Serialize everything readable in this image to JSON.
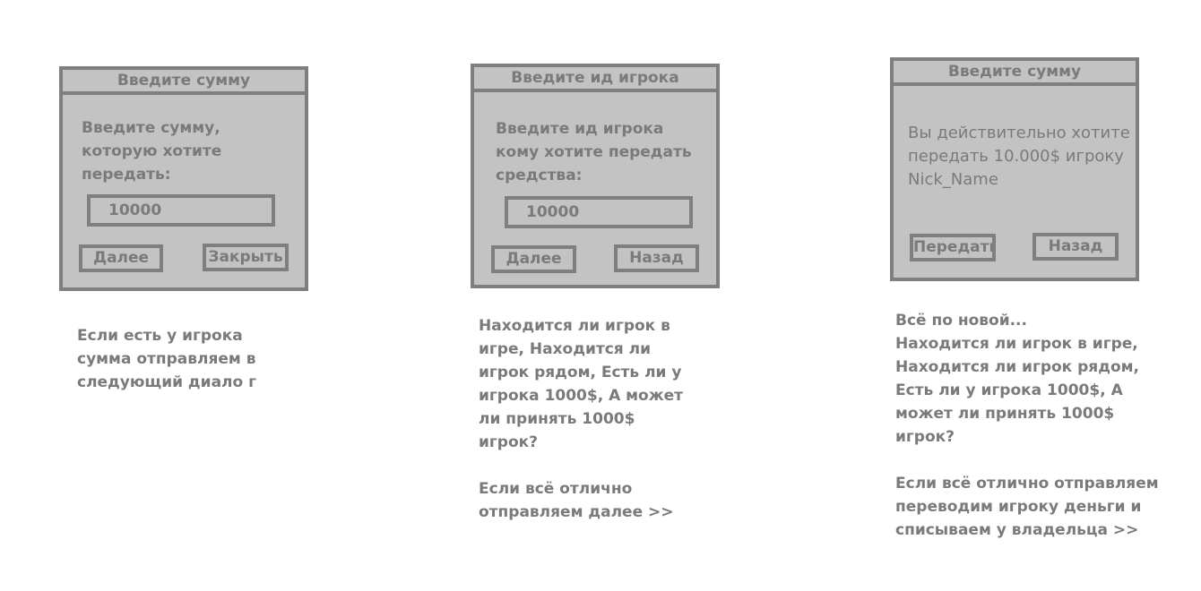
{
  "dialogs": [
    {
      "title": "Введите сумму",
      "message": "Введите сумму,\nкоторую хотите\nпередать:",
      "input_value": "10000",
      "buttons": [
        "Далее",
        "Закрыть"
      ],
      "note": "Если есть у игрока\nсумма отправляем в\nследующий диало г"
    },
    {
      "title": "Введите ид игрока",
      "message": "Введите ид игрока\nкому хотите передать\nсредства:",
      "input_value": "10000",
      "buttons": [
        "Далее",
        "Назад"
      ],
      "note": "Находится ли игрок в\nигре, Находится ли\nигрок рядом, Есть ли у\nигрока 1000$, А может\nли принять 1000$\nигрок?\n\nЕсли всё отлично\nотправляем далее >>"
    },
    {
      "title": "Введите сумму",
      "message": "Вы действительно хотите\nпередать 10.000$ игроку\nNick_Name",
      "buttons": [
        "Передать",
        "Назад"
      ],
      "note": "Всё по новой...\nНаходится ли игрок в игре,\nНаходится ли игрок рядом,\nЕсть ли у игрока 1000$, А\nможет ли принять 1000$\nигрок?\n\nЕсли всё отлично отправляем\nпереводим игроку деньги и\nсписываем у владельца >>"
    }
  ]
}
